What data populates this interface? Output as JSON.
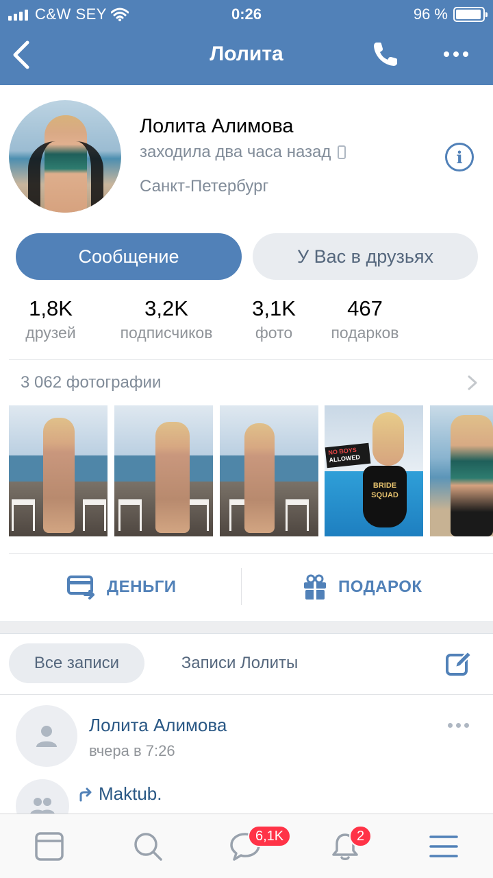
{
  "status_bar": {
    "carrier": "C&W SEY",
    "time": "0:26",
    "battery_text": "96 %",
    "battery_level": 0.96
  },
  "nav": {
    "title": "Лолита",
    "icons": [
      "back-chevron-icon",
      "phone-icon",
      "more-dots-icon"
    ]
  },
  "profile": {
    "name": "Лолита Алимова",
    "last_seen": "заходила два часа назад",
    "city": "Санкт-Петербург",
    "info_icon": "info-icon"
  },
  "buttons": {
    "message": "Сообщение",
    "friends": "У Вас в друзьях"
  },
  "counters": [
    {
      "value": "1,8K",
      "label": "друзей"
    },
    {
      "value": "3,2K",
      "label": "подписчиков"
    },
    {
      "value": "3,1K",
      "label": "фото"
    },
    {
      "value": "467",
      "label": "подарков"
    }
  ],
  "photos": {
    "header": "3 062 фотографии",
    "sign_line1": "NO BOYS",
    "sign_line2": "ALLOWED",
    "suit_line1": "BRIDE",
    "suit_line2": "SQUAD"
  },
  "actions": {
    "money": "ДЕНЬГИ",
    "gift": "ПОДАРОК"
  },
  "wall_tabs": {
    "all": "Все записи",
    "own": "Записи Лолиты"
  },
  "posts": [
    {
      "author": "Лолита Алимова",
      "time": "вчера в 7:26"
    },
    {
      "author": "Maktub.",
      "time": ""
    }
  ],
  "tabbar": {
    "messages_badge": "6,1K",
    "notifications_badge": "2"
  },
  "colors": {
    "accent": "#5181b8",
    "secondary_text": "#818c99",
    "badge": "#ff3347"
  }
}
